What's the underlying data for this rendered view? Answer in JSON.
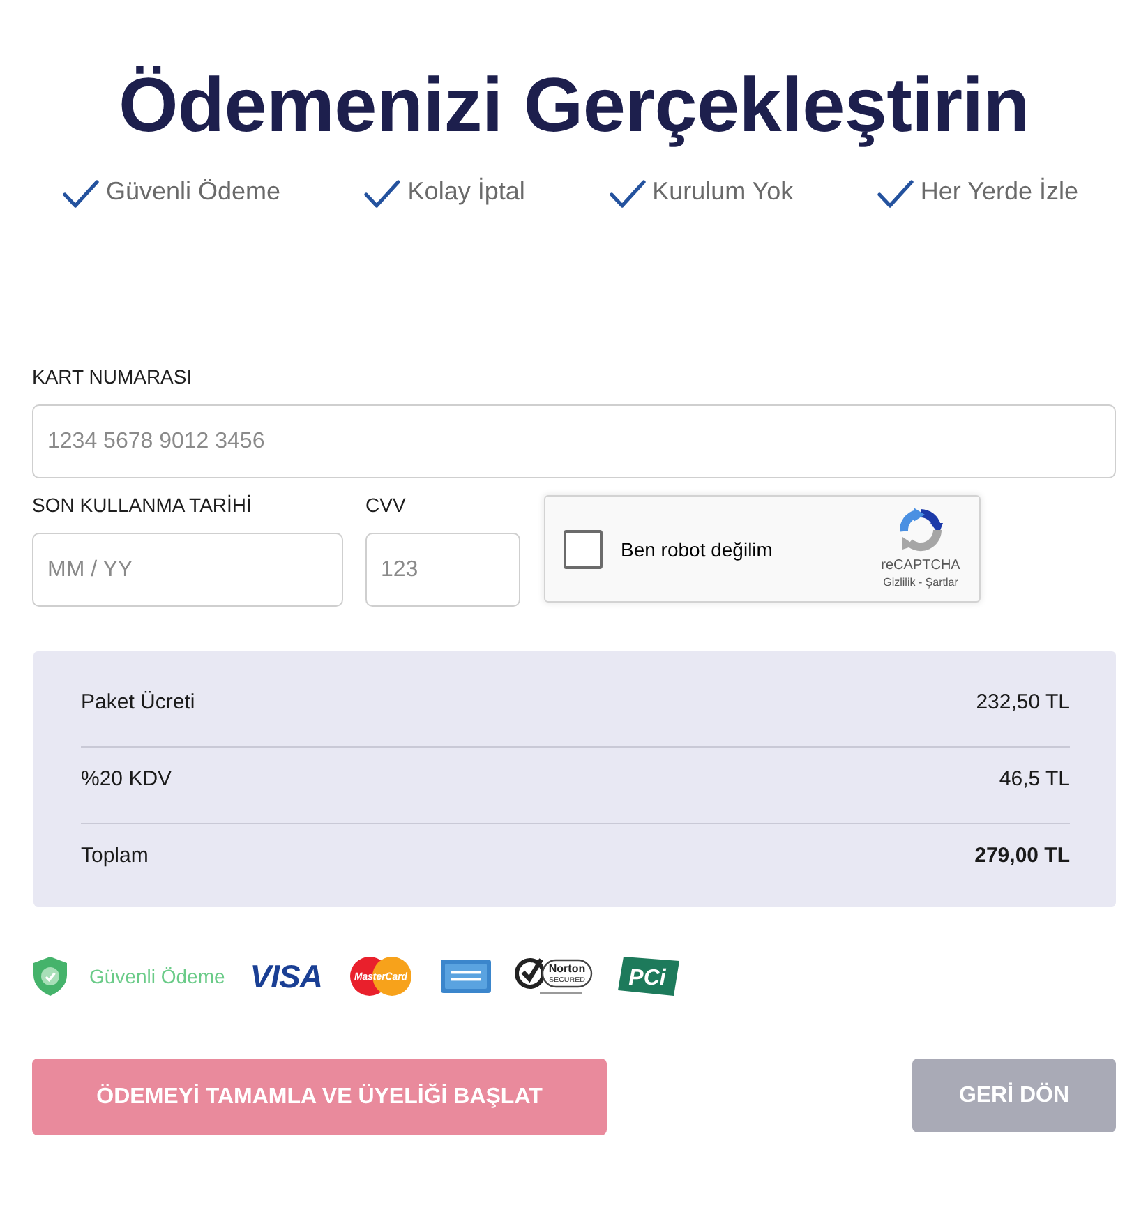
{
  "title": "Ödemenizi Gerçekleştirin",
  "features": [
    {
      "label": "Güvenli Ödeme"
    },
    {
      "label": "Kolay İptal"
    },
    {
      "label": "Kurulum Yok"
    },
    {
      "label": "Her Yerde İzle"
    }
  ],
  "form": {
    "card_number": {
      "label": "KART NUMARASI",
      "placeholder": "1234 5678 9012 3456"
    },
    "expiry": {
      "label": "SON KULLANMA TARİHİ",
      "placeholder": "MM / YY"
    },
    "cvv": {
      "label": "CVV",
      "placeholder": "123"
    },
    "captcha": {
      "label": "Ben robot değilim",
      "checked": false,
      "brand": "reCAPTCHA",
      "links": "Gizlilik - Şartlar"
    }
  },
  "summary": [
    {
      "label": "Paket Ücreti",
      "value": "232,50 TL",
      "total": false
    },
    {
      "label": "%20 KDV",
      "value": "46,5 TL",
      "total": false
    },
    {
      "label": "Toplam",
      "value": "279,00 TL",
      "total": true
    }
  ],
  "badges": [
    {
      "kind": "shield"
    },
    {
      "kind": "label",
      "text": "Güvenli Ödeme"
    },
    {
      "kind": "visa",
      "text": "VISA"
    },
    {
      "kind": "mastercard",
      "text": "MasterCard"
    },
    {
      "kind": "amex"
    },
    {
      "kind": "norton",
      "text": "Norton",
      "subtext": "SECURED"
    },
    {
      "kind": "pci",
      "text": "PCi"
    }
  ],
  "buttons": [
    {
      "kind": "primary",
      "label": "ÖDEMEYİ TAMAMLA VE ÜYELİĞİ BAŞLAT"
    },
    {
      "kind": "secondary",
      "label": "GERİ DÖN"
    }
  ]
}
